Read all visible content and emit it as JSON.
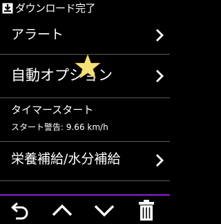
{
  "status": {
    "title": "ダウンロード完了",
    "icon": "download-complete-icon"
  },
  "menu": {
    "items": [
      {
        "label": "アラート",
        "icon": "chevron-right-icon"
      },
      {
        "label": "自動オプション",
        "icon": "chevron-right-icon"
      },
      {
        "label": "タイマースタート",
        "sublabel": "スタート警告: 9.66 km/h"
      },
      {
        "label": "栄養補給/水分補給",
        "icon": "chevron-right-icon"
      }
    ]
  },
  "overlay": {
    "icon": "star-icon",
    "color": "#f5e07a"
  },
  "toolbar": {
    "accent": "#8e1ed8",
    "icons": [
      "back-icon",
      "chevron-up-icon",
      "chevron-down-icon",
      "trash-icon"
    ]
  }
}
